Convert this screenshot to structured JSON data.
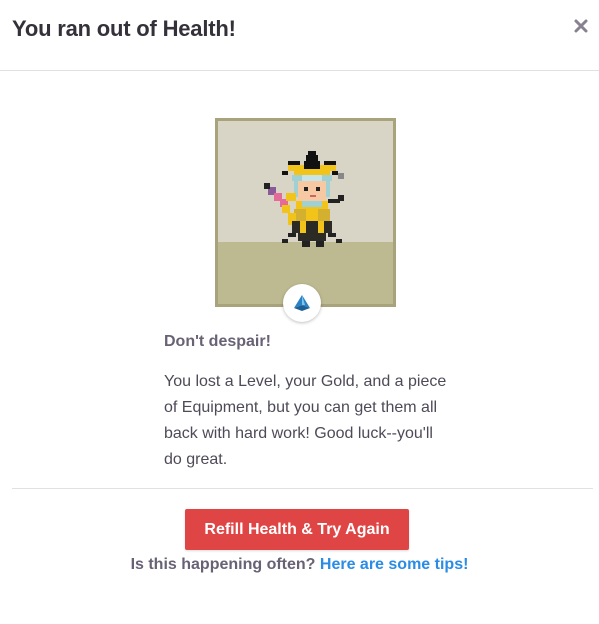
{
  "dialog": {
    "title": "You ran out of Health!",
    "close_icon": "close-icon"
  },
  "avatar": {
    "background_color": "#d8d5c6",
    "ground_color": "#bdba91",
    "border_color": "#a9a37b",
    "class_icon": "class-badge-icon"
  },
  "message": {
    "subtitle": "Don't despair!",
    "body": "You lost a Level, your Gold, and a piece of Equipment, but you can get them all back with hard work! Good luck--you'll do great."
  },
  "actions": {
    "refill_button": "Refill Health & Try Again",
    "refill_color": "#e04545",
    "tips_prefix": "Is this happening often?",
    "tips_link": "Here are some tips!",
    "link_color": "#2a8ce4"
  }
}
